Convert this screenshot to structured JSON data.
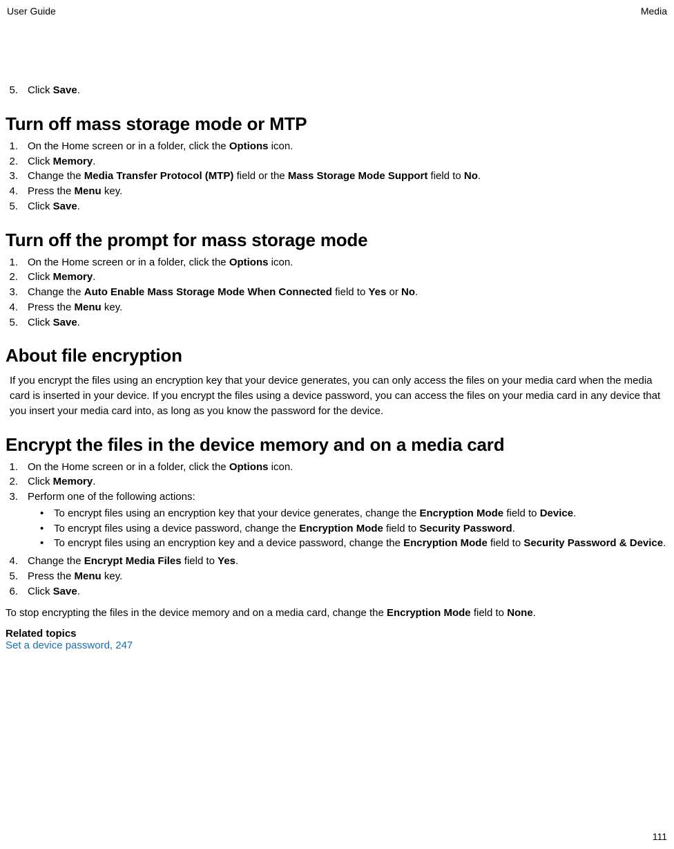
{
  "header": {
    "left": "User Guide",
    "right": "Media"
  },
  "page_number": "111",
  "previous_tail": {
    "items": [
      {
        "n": "5.",
        "parts": [
          [
            "Click ",
            0
          ],
          [
            "Save",
            1
          ],
          [
            ".",
            0
          ]
        ]
      }
    ]
  },
  "sections": [
    {
      "title": "Turn off mass storage mode or MTP",
      "ol": [
        {
          "n": "1.",
          "parts": [
            [
              "On the Home screen or in a folder, click the ",
              0
            ],
            [
              "Options",
              1
            ],
            [
              " icon.",
              0
            ]
          ]
        },
        {
          "n": "2.",
          "parts": [
            [
              "Click ",
              0
            ],
            [
              "Memory",
              1
            ],
            [
              ".",
              0
            ]
          ]
        },
        {
          "n": "3.",
          "parts": [
            [
              "Change the ",
              0
            ],
            [
              "Media Transfer Protocol (MTP)",
              1
            ],
            [
              " field or the ",
              0
            ],
            [
              "Mass Storage Mode Support",
              1
            ],
            [
              " field to ",
              0
            ],
            [
              "No",
              1
            ],
            [
              ".",
              0
            ]
          ]
        },
        {
          "n": "4.",
          "parts": [
            [
              "Press the ",
              0
            ],
            [
              "Menu",
              1
            ],
            [
              " key.",
              0
            ]
          ]
        },
        {
          "n": "5.",
          "parts": [
            [
              "Click ",
              0
            ],
            [
              "Save",
              1
            ],
            [
              ".",
              0
            ]
          ]
        }
      ]
    },
    {
      "title": "Turn off the prompt for mass storage mode",
      "ol": [
        {
          "n": "1.",
          "parts": [
            [
              "On the Home screen or in a folder, click the ",
              0
            ],
            [
              "Options",
              1
            ],
            [
              " icon.",
              0
            ]
          ]
        },
        {
          "n": "2.",
          "parts": [
            [
              "Click ",
              0
            ],
            [
              "Memory",
              1
            ],
            [
              ".",
              0
            ]
          ]
        },
        {
          "n": "3.",
          "parts": [
            [
              "Change the ",
              0
            ],
            [
              "Auto Enable Mass Storage Mode When Connected",
              1
            ],
            [
              " field to ",
              0
            ],
            [
              "Yes",
              1
            ],
            [
              " or ",
              0
            ],
            [
              "No",
              1
            ],
            [
              ".",
              0
            ]
          ]
        },
        {
          "n": "4.",
          "parts": [
            [
              "Press the ",
              0
            ],
            [
              "Menu",
              1
            ],
            [
              " key.",
              0
            ]
          ]
        },
        {
          "n": "5.",
          "parts": [
            [
              "Click ",
              0
            ],
            [
              "Save",
              1
            ],
            [
              ".",
              0
            ]
          ]
        }
      ]
    },
    {
      "title": "About file encryption",
      "para": [
        [
          "If you encrypt the files using an encryption key that your device generates, you can only access the files on your media card when the media card is inserted in your device. If you encrypt the files using a device password, you can access the files on your media card in any device that you insert your media card into, as long as you know the password for the device.",
          0
        ]
      ]
    },
    {
      "title": "Encrypt the files in the device memory and on a media card",
      "ol": [
        {
          "n": "1.",
          "parts": [
            [
              "On the Home screen or in a folder, click the ",
              0
            ],
            [
              "Options",
              1
            ],
            [
              " icon.",
              0
            ]
          ]
        },
        {
          "n": "2.",
          "parts": [
            [
              "Click ",
              0
            ],
            [
              "Memory",
              1
            ],
            [
              ".",
              0
            ]
          ]
        },
        {
          "n": "3.",
          "parts": [
            [
              "Perform one of the following actions:",
              0
            ]
          ],
          "sub_bullets": [
            [
              [
                "To encrypt files using an encryption key that your device generates, change the ",
                0
              ],
              [
                "Encryption Mode",
                1
              ],
              [
                " field to ",
                0
              ],
              [
                "Device",
                1
              ],
              [
                ".",
                0
              ]
            ],
            [
              [
                "To encrypt files using a device password, change the ",
                0
              ],
              [
                "Encryption Mode",
                1
              ],
              [
                " field to ",
                0
              ],
              [
                "Security Password",
                1
              ],
              [
                ".",
                0
              ]
            ],
            [
              [
                "To encrypt files using an encryption key and a device password, change the ",
                0
              ],
              [
                "Encryption Mode",
                1
              ],
              [
                " field to ",
                0
              ],
              [
                "Security Password & Device",
                1
              ],
              [
                ".",
                0
              ]
            ]
          ]
        },
        {
          "n": "4.",
          "parts": [
            [
              "Change the ",
              0
            ],
            [
              "Encrypt Media Files",
              1
            ],
            [
              " field to ",
              0
            ],
            [
              "Yes",
              1
            ],
            [
              ".",
              0
            ]
          ]
        },
        {
          "n": "5.",
          "parts": [
            [
              "Press the ",
              0
            ],
            [
              "Menu",
              1
            ],
            [
              " key.",
              0
            ]
          ]
        },
        {
          "n": "6.",
          "parts": [
            [
              "Click ",
              0
            ],
            [
              "Save",
              1
            ],
            [
              ".",
              0
            ]
          ]
        }
      ],
      "after_para": [
        [
          "To stop encrypting the files in the device memory and on a media card, change the ",
          0
        ],
        [
          "Encryption Mode",
          1
        ],
        [
          " field to ",
          0
        ],
        [
          "None",
          1
        ],
        [
          ".",
          0
        ]
      ],
      "related": {
        "heading": "Related topics",
        "links": [
          "Set a device password, 247"
        ]
      }
    }
  ]
}
